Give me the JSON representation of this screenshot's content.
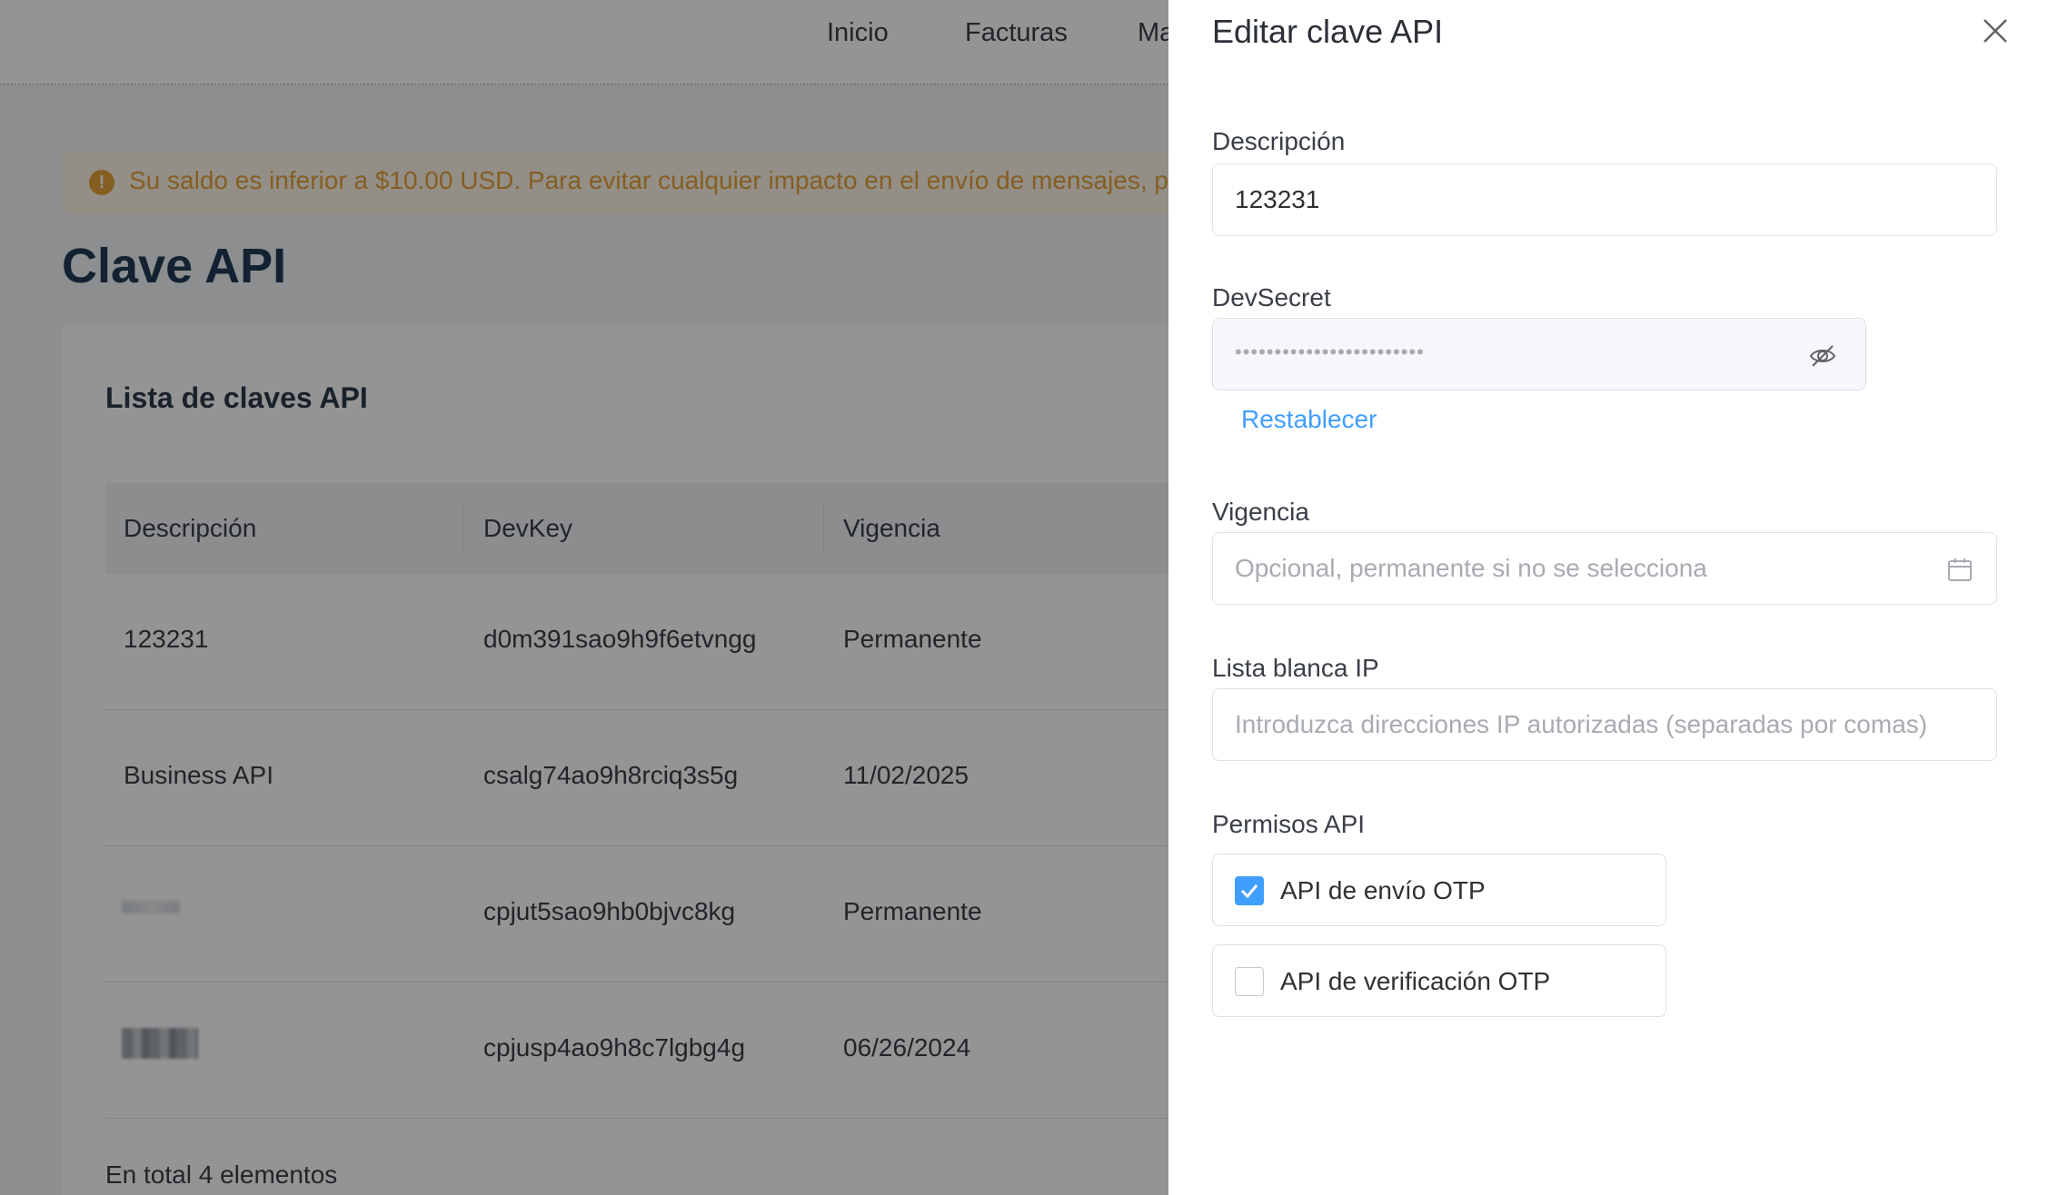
{
  "nav": {
    "items": [
      "Inicio",
      "Facturas",
      "Ma"
    ]
  },
  "alert": {
    "text": "Su saldo es inferior a $10.00 USD. Para evitar cualquier impacto en el envío de mensajes, p",
    "icon": "exclamation-icon"
  },
  "page": {
    "title": "Clave API"
  },
  "list": {
    "title": "Lista de claves API",
    "headers": [
      "Descripción",
      "DevKey",
      "Vigencia"
    ],
    "rows": [
      {
        "description": "123231",
        "devkey": "d0m391sao9h9f6etvngg",
        "validity": "Permanente"
      },
      {
        "description": "Business API",
        "devkey": "csalg74ao9h8rciq3s5g",
        "validity": "11/02/2025"
      },
      {
        "description": "",
        "devkey": "cpjut5sao9hb0bjvc8kg",
        "validity": "Permanente"
      },
      {
        "description": "",
        "devkey": "cpjusp4ao9h8c7lgbg4g",
        "validity": "06/26/2024"
      }
    ],
    "total": "En total 4 elementos"
  },
  "drawer": {
    "title": "Editar clave API",
    "description": {
      "label": "Descripción",
      "value": "123231"
    },
    "devsecret": {
      "label": "DevSecret",
      "value": "••••••••••••••••••••••••",
      "reset_label": "Restablecer"
    },
    "validity": {
      "label": "Vigencia",
      "placeholder": "Opcional, permanente si no se selecciona"
    },
    "whitelist": {
      "label": "Lista blanca IP",
      "placeholder": "Introduzca direcciones IP autorizadas (separadas por comas)"
    },
    "permissions": {
      "label": "Permisos API",
      "items": [
        {
          "label": "API de envío OTP",
          "checked": true
        },
        {
          "label": "API de verificación OTP",
          "checked": false
        }
      ]
    }
  },
  "colors": {
    "primary": "#409eff",
    "warning": "#e6a23c",
    "title": "#1f3b57"
  }
}
